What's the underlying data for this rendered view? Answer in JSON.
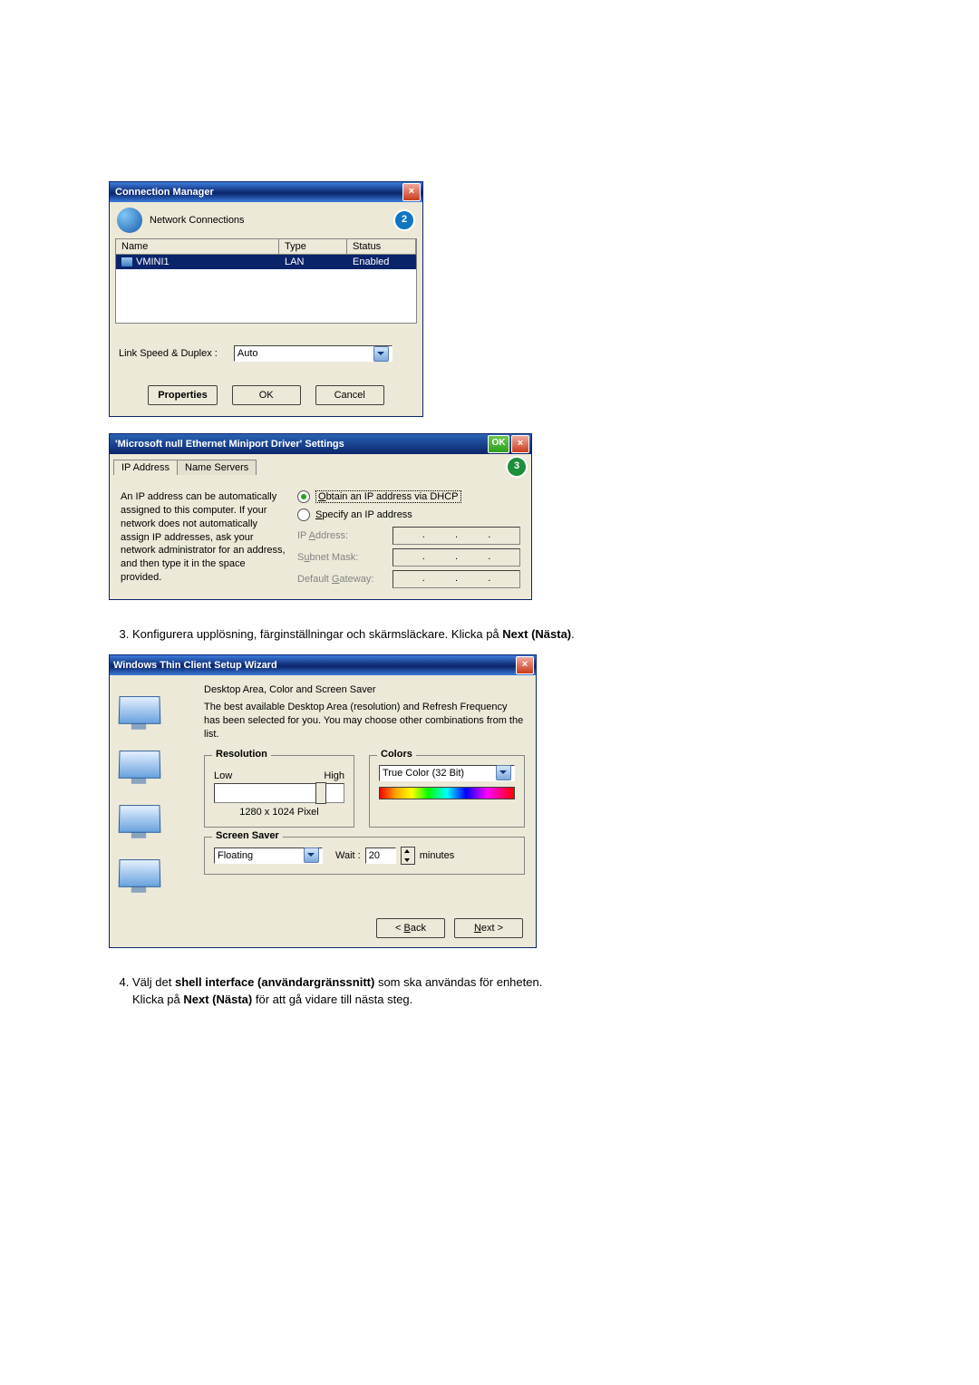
{
  "cm": {
    "title": "Connection Manager",
    "heading": "Network Connections",
    "badge": "2",
    "columns": {
      "name": "Name",
      "type": "Type",
      "status": "Status"
    },
    "row": {
      "name": "VMINI1",
      "type": "LAN",
      "status": "Enabled"
    },
    "link_label": "Link Speed & Duplex :",
    "link_value": "Auto",
    "buttons": {
      "properties": "Properties",
      "ok": "OK",
      "cancel": "Cancel"
    }
  },
  "mp": {
    "title": "'Microsoft null Ethernet Miniport Driver' Settings",
    "title_ok": "OK",
    "tabs": {
      "ip": "IP Address",
      "ns": "Name Servers"
    },
    "badge": "3",
    "desc": "An IP address can be automatically assigned to this computer.  If your network does not automatically assign IP addresses, ask your network administrator for an address, and then type it in the space provided.",
    "opt_dhcp": "Obtain an IP address via DHCP",
    "opt_spec": "Specify an IP address",
    "ip_label": "IP Address:",
    "mask_label": "Subnet Mask:",
    "gw_label": "Default Gateway:"
  },
  "step3": {
    "num": "3.",
    "text": "Konfigurera upplösning, färginställningar och skärmsläckare. Klicka på ",
    "bold": "Next (Nästa)",
    "tail": "."
  },
  "wz": {
    "title": "Windows Thin Client Setup Wizard",
    "heading": "Desktop Area, Color and Screen Saver",
    "sub": "The best available Desktop Area (resolution) and Refresh Frequency has been selected for you.  You may choose other combinations from the list.",
    "res_legend": "Resolution",
    "res_low": "Low",
    "res_high": "High",
    "res_value": "1280 x 1024 Pixel",
    "col_legend": "Colors",
    "col_value": "True Color (32 Bit)",
    "ss_legend": "Screen Saver",
    "ss_value": "Floating",
    "wait_label": "Wait :",
    "wait_value": "20",
    "wait_unit": "minutes",
    "back": "< Back",
    "next": "Next >"
  },
  "step4": {
    "num": "4.",
    "a": "Välj det ",
    "b": "shell interface (användargränssnitt)",
    "c": " som ska användas för enheten.",
    "d": "Klicka på ",
    "e": "Next (Nästa)",
    "f": " för att gå vidare till nästa steg."
  }
}
